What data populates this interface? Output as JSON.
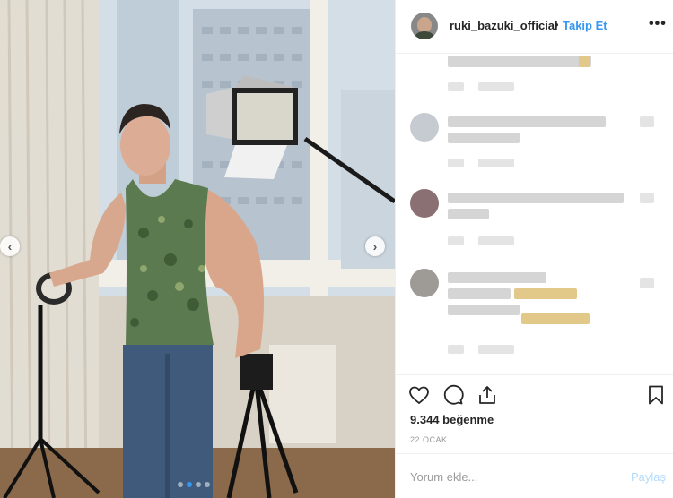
{
  "header": {
    "username": "ruki_bazuki_official",
    "bullet": "•",
    "follow_label": "Takip Et",
    "more_label": "•••"
  },
  "media": {
    "prev_icon": "‹",
    "next_icon": "›",
    "slide_count": 4,
    "active_slide": 2
  },
  "actions": {
    "likes_text": "9.344 beğenme",
    "date_text": "22 OCAK"
  },
  "comment_box": {
    "placeholder": "Yorum ekle...",
    "post_label": "Paylaş"
  },
  "colors": {
    "link_blue": "#3897f0",
    "disabled_blue": "#b3dbff",
    "border": "#efefef"
  },
  "icons": [
    "heart-icon",
    "comment-icon",
    "share-icon",
    "bookmark-icon",
    "more-options-icon",
    "chevron-left-icon",
    "chevron-right-icon"
  ]
}
